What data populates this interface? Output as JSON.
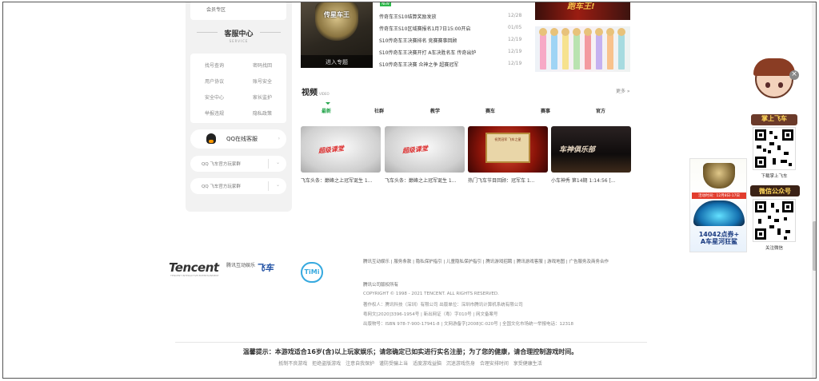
{
  "left_panel": {
    "top_item": "会员专区",
    "cs_title": "客服中心",
    "cs_sub": "SERVICE",
    "cs_links": [
      "找号查询",
      "密码找回",
      "用户协议",
      "账号安全",
      "安全中心",
      "家长监护",
      "举报违规",
      "隐私政策"
    ],
    "qq_service": "QQ在线客服",
    "qq_group1": "QQ 飞车官方玩家群",
    "qq_group2": "QQ 飞车官方玩家群"
  },
  "news": {
    "banner_title": "传星车王",
    "banner_enter": "进入专题",
    "new_tag": "NEW",
    "items": [
      {
        "title": "传奇车王S10结算奖励发放",
        "date": "12/28"
      },
      {
        "title": "传奇车王S10区域赛报名1月7日15:00开启",
        "date": "01/05"
      },
      {
        "title": "S10传奇车王决赛排名 竞赛赛事回顾",
        "date": "12/19"
      },
      {
        "title": "S10传奇车王决赛开打 A车决胜名车 传奇出炉",
        "date": "12/19"
      },
      {
        "title": "S10传奇车王决赛 众神之争 超赛冠军",
        "date": "12/19"
      }
    ],
    "thumb_a_text": "跑车王!"
  },
  "video": {
    "title": "视频",
    "title_sub": "VIDEO",
    "more": "更多 »",
    "tabs": [
      "最新",
      "社群",
      "教学",
      "赛车",
      "赛事",
      "官方"
    ],
    "thumbs": [
      {
        "caption": "飞车头条：巅峰之上冠军诞生 1...",
        "art": "超级课堂"
      },
      {
        "caption": "飞车头条：巅峰之上冠军诞生 1...",
        "art": "超级课堂"
      },
      {
        "caption": "热门飞车节目回顾：冠军车 1...",
        "art": "祝贺冠军 飞车之星"
      },
      {
        "caption": "小车神秀 第14期 1:14:56 [...",
        "art": "车神俱乐部"
      }
    ]
  },
  "footer": {
    "tencent": "Tencent",
    "tencent_sub": "腾讯互动娱乐",
    "tencent_small": "TENCENT INTERACTIVE ENTERTAINMENT",
    "qq_speed": "飞车",
    "timi": "TiMi",
    "links": "腾讯互动娱乐 | 服务条款 | 隐私保护指引 | 儿童隐私保护指引 | 腾讯游戏招聘 | 腾讯游戏客服 | 游戏地图 | 广告服务及商务合作",
    "copyright_title": "腾讯公司版权所有",
    "copyright": "COPYRIGHT © 1998 - 2021 TENCENT. ALL RIGHTS RESERVED.",
    "company": "著作权人：腾讯科技（深圳）有限公司   出版单位：深圳市腾讯计算机系统有限公司",
    "license": "粤网文[2020]3396-1954号 | 新出网证（粤）字010号 | 网文备案号",
    "isbn": "出版物号：ISBN 978-7-900-17941-8 | 文网游备字[2008]C-020号 | 全国文化市场统一举报电话：12318",
    "warning": "温馨提示：本游戏适合16岁(含)以上玩家娱乐；请您确定已如实进行实名注册；为了您的健康，请合理控制游戏时间。",
    "bottom_links": [
      "抵制不良游戏",
      "拒绝盗版游戏",
      "注意自我保护",
      "谨防受骗上当",
      "适度游戏益脑",
      "沉迷游戏伤身",
      "合理安排时间",
      "享受健康生活"
    ]
  },
  "right_float": {
    "mascot_tag": "掌上飞车",
    "qr1_caption": "下载掌上飞车",
    "wechat_title": "微信公众号",
    "qr2_caption": "关注微信",
    "ad_date": "活动时间：12月8日-17日",
    "ad_points": "14042点券+",
    "ad_line2": "A车星河狂鲨"
  }
}
